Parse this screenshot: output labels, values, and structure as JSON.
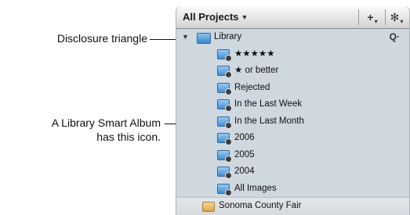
{
  "callouts": {
    "disclosure": "Disclosure triangle",
    "smart_album_line1": "A Library Smart Album",
    "smart_album_line2": "has this icon."
  },
  "toolbar": {
    "projects_menu_label": "All Projects",
    "add_button_label": "+",
    "action_button_label": "✻"
  },
  "library": {
    "label": "Library",
    "items": [
      {
        "label": "★★★★★"
      },
      {
        "label": "★ or better"
      },
      {
        "label": "Rejected"
      },
      {
        "label": "In the Last Week"
      },
      {
        "label": "In the Last Month"
      },
      {
        "label": "2006"
      },
      {
        "label": "2005"
      },
      {
        "label": "2004"
      },
      {
        "label": "All Images"
      }
    ]
  },
  "project": {
    "label": "Sonoma County Fair"
  }
}
